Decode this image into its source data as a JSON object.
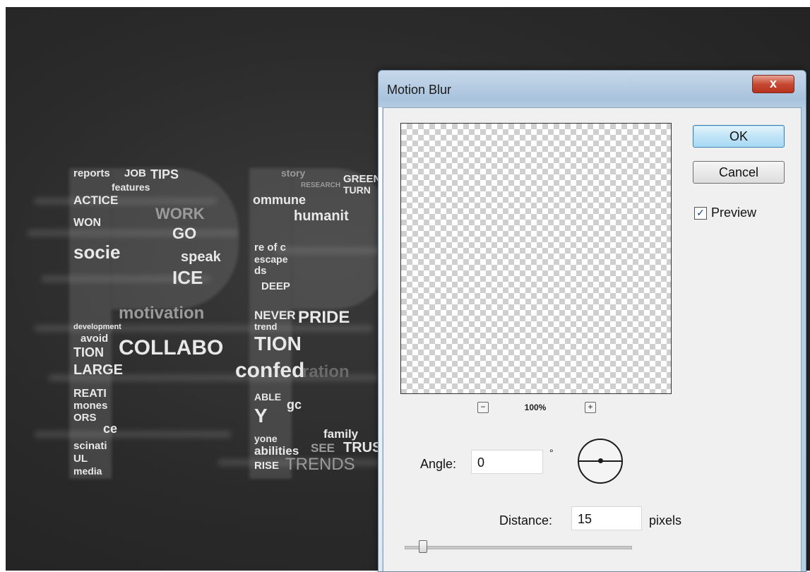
{
  "window": {
    "title": "Motion Blur",
    "close_label": "x"
  },
  "buttons": {
    "ok_label": "OK",
    "cancel_label": "Cancel"
  },
  "preview": {
    "checkbox_label": "Preview",
    "checked": true,
    "zoom_level": "100%",
    "zoom_out_label": "−",
    "zoom_in_label": "+"
  },
  "angle": {
    "label": "Angle:",
    "value": "0",
    "unit": "°"
  },
  "distance": {
    "label": "Distance:",
    "value": "15",
    "unit": "pixels",
    "slider_fraction": 0.08
  },
  "canvas": {
    "words": [
      "reports",
      "JOB",
      "TIPS",
      "features",
      "ACTICE",
      "WORK",
      "WON",
      "GO",
      "socie",
      "speak",
      "ICE",
      "motivation",
      "development",
      "avoid",
      "COLLABO",
      "TION",
      "LARGE",
      "REATI",
      "mones",
      "ORS",
      "ce",
      "scinati",
      "UL",
      "media",
      "story",
      "RESEARCH",
      "GREEN",
      "TURN",
      "ommune",
      "humanit",
      "re of c",
      "escape",
      "ds",
      "DEEP",
      "NEVER",
      "trend",
      "PRIDE",
      "TION",
      "confed",
      "ration",
      "ABLE",
      "gc",
      "Y",
      "yone",
      "family",
      "abilities",
      "SEE",
      "TRUS",
      "RISE",
      "TRENDS"
    ]
  }
}
